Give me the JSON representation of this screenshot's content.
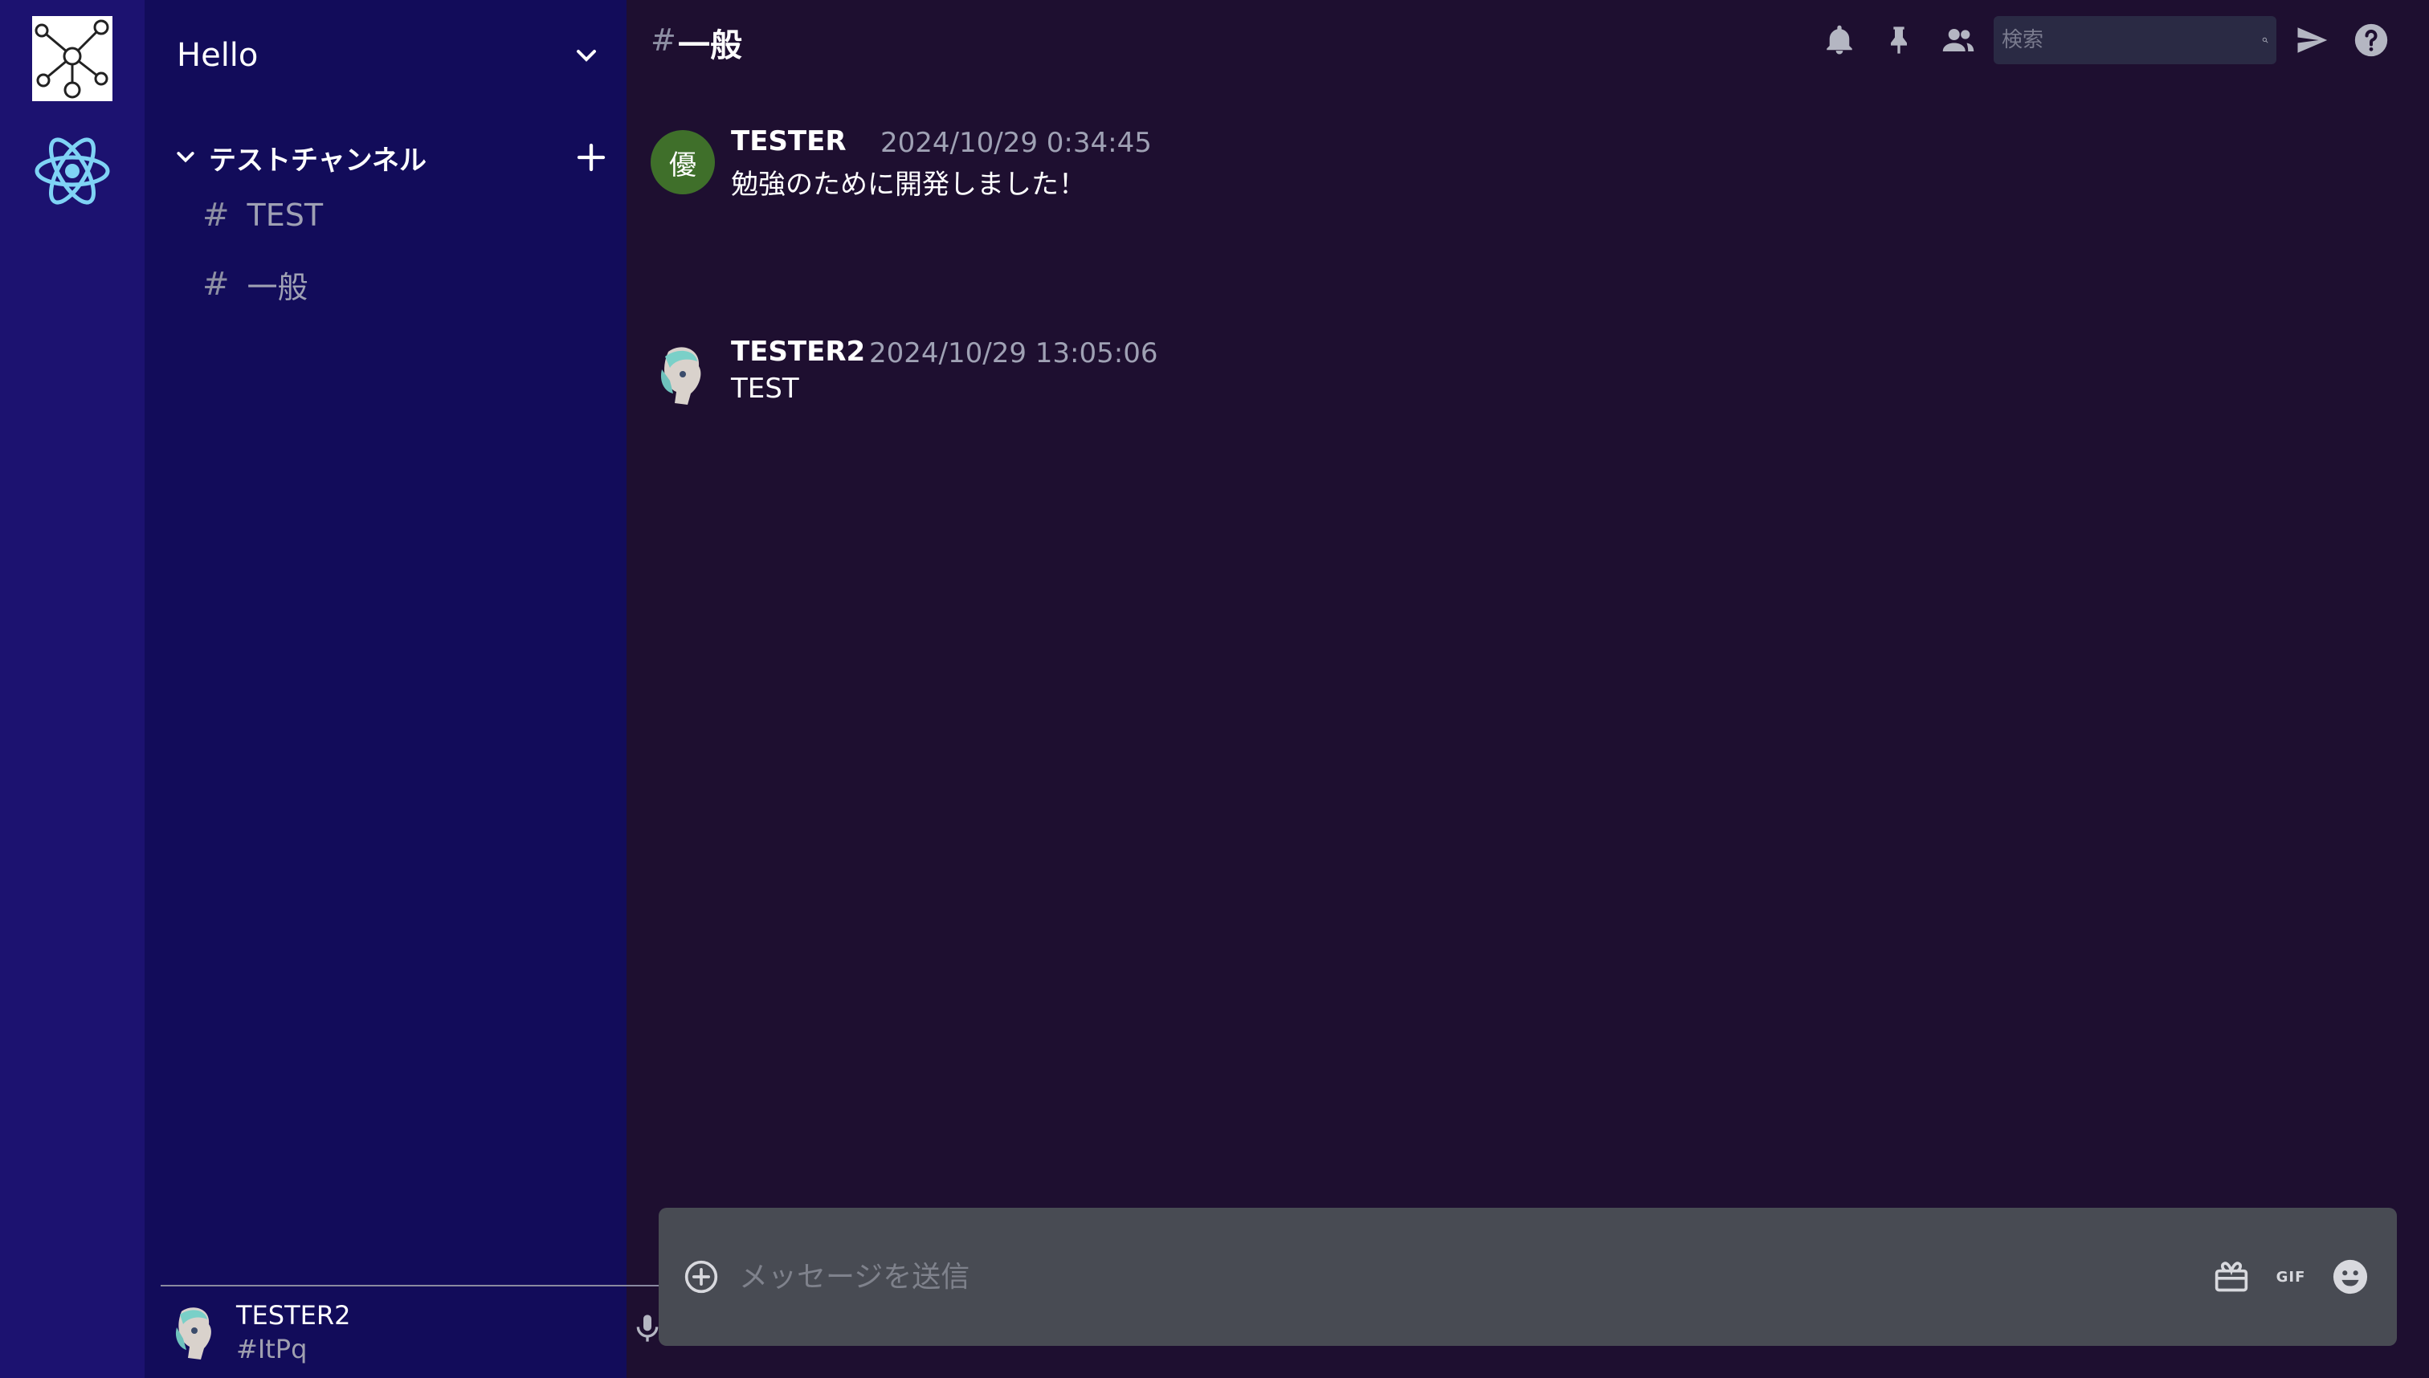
{
  "rail": {
    "servers": [
      {
        "icon": "network-graph-icon"
      },
      {
        "icon": "react-atom-icon"
      }
    ]
  },
  "sidebar": {
    "server_name": "Hello",
    "category": {
      "label": "テストチャンネル"
    },
    "channels": [
      {
        "hash": "#",
        "name": "TEST"
      },
      {
        "hash": "#",
        "name": "一般"
      }
    ]
  },
  "user_panel": {
    "name": "TESTER2",
    "tag": "#ItPq"
  },
  "chat_header": {
    "hash": "#",
    "title": "一般",
    "search_placeholder": "検索"
  },
  "messages": [
    {
      "avatar_initial": "優",
      "author": "TESTER",
      "timestamp": "2024/10/29 0:34:45",
      "text": "勉強のために開発しました！"
    },
    {
      "avatar_initial": "",
      "author": "TESTER2",
      "timestamp": "2024/10/29 13:05:06",
      "text": "TEST"
    }
  ],
  "composer": {
    "placeholder": "メッセージを送信",
    "gif_label": "GIF"
  },
  "colors": {
    "rail_bg": "#1c1270",
    "sidebar_bg": "#120c5a",
    "chat_bg": "#1e0f30",
    "composer_bg": "#484b53",
    "avatar_green": "#3f6f2a",
    "react_blue": "#7fd3f5"
  }
}
